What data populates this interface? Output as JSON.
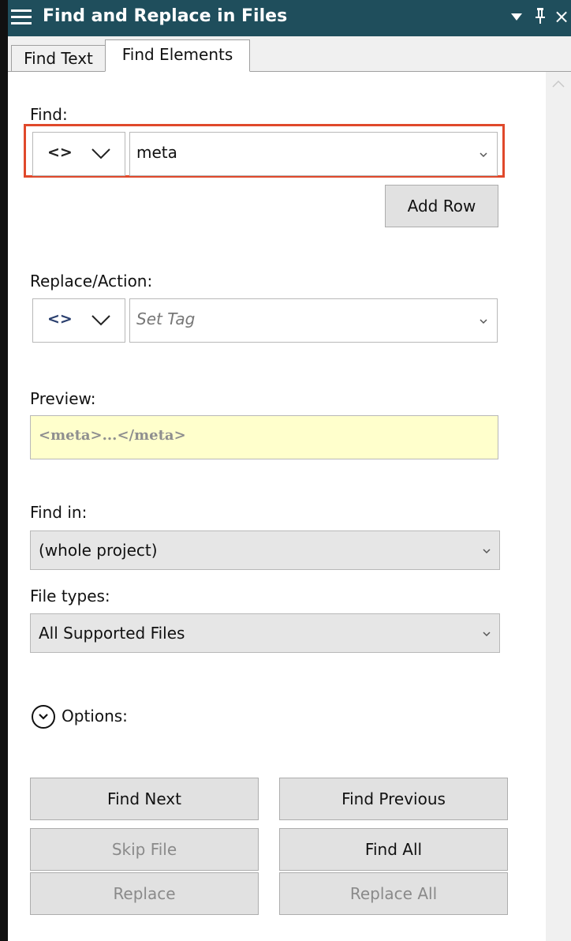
{
  "window": {
    "title": "Find and Replace in Files",
    "pin_glyph": "ᵯ",
    "controls": {
      "dropdown": "▼",
      "pin": "Ԅ",
      "close": "×"
    }
  },
  "tabs": [
    {
      "label": "Find Text",
      "active": false
    },
    {
      "label": "Find Elements",
      "active": true
    }
  ],
  "find": {
    "label": "Find:",
    "type_glyph": "<>",
    "value": "meta",
    "add_row_label": "Add Row",
    "highlight_color": "#e0492b"
  },
  "replace": {
    "label": "Replace/Action:",
    "type_glyph": "<>",
    "placeholder": "Set Tag"
  },
  "preview": {
    "label": "Preview:",
    "value": "<meta>...</meta>",
    "background": "#ffffcc"
  },
  "find_in": {
    "label": "Find in:",
    "value": "(whole project)"
  },
  "file_types": {
    "label": "File types:",
    "value": "All Supported Files"
  },
  "options": {
    "label": "Options:",
    "icon": "chevron-down-circle-icon"
  },
  "buttons": {
    "find_next": "Find Next",
    "find_previous": "Find Previous",
    "skip_file": "Skip File",
    "find_all": "Find All",
    "replace": "Replace",
    "replace_all": "Replace All"
  },
  "colors": {
    "titlebar": "#1f4e5c",
    "button_face": "#e1e1e1",
    "disabled_text": "#8a8a8a"
  }
}
